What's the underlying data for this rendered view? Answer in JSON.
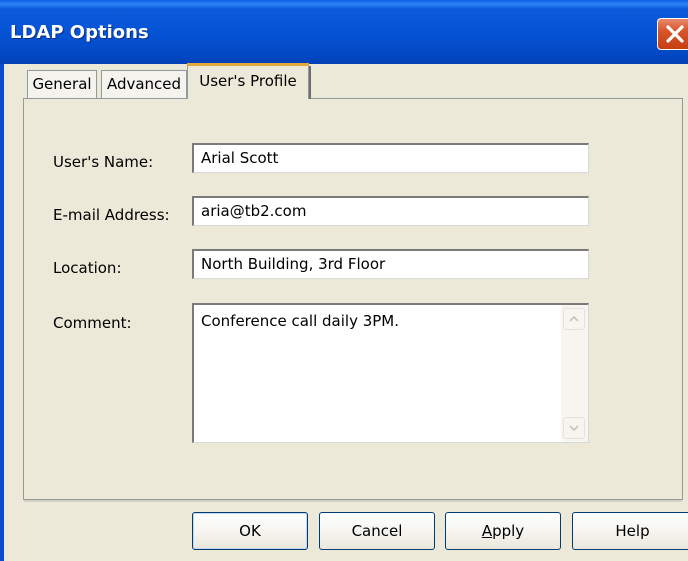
{
  "window": {
    "title": "LDAP Options",
    "close_icon": "close-icon"
  },
  "tabs": [
    {
      "label": "General",
      "selected": false
    },
    {
      "label": "Advanced",
      "selected": false
    },
    {
      "label": "User's Profile",
      "selected": true
    }
  ],
  "form": {
    "name_label": "User's Name:",
    "name_value": "Arial Scott",
    "email_label": "E-mail Address:",
    "email_value": "aria@tb2.com",
    "location_label": "Location:",
    "location_value": "North Building, 3rd Floor",
    "comment_label": "Comment:",
    "comment_value": "Conference call daily 3PM."
  },
  "buttons": {
    "ok": "OK",
    "cancel": "Cancel",
    "apply_first": "A",
    "apply_rest": "pply",
    "help": "Help"
  },
  "colors": {
    "titlebar": "#0554d6",
    "dialog_bg": "#ece9d8",
    "close_button": "#d8542b",
    "selected_tab_accent": "#e2a83c"
  }
}
